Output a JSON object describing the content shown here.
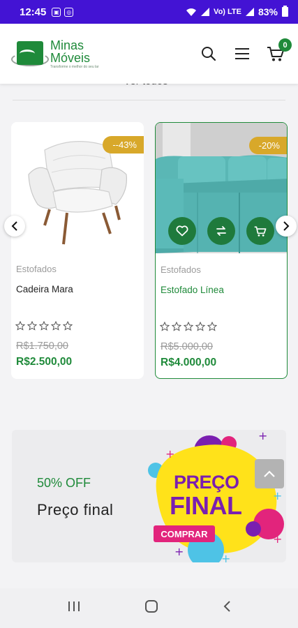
{
  "status_bar": {
    "time": "12:45",
    "battery": "83%",
    "signal_text": "Vo) LTE"
  },
  "header": {
    "logo": {
      "line1": "Minas",
      "line2": "Móveis",
      "tagline": "Transforme o melhor do seu lar"
    },
    "cart_count": "0",
    "icons": [
      "search-icon",
      "menu-icon",
      "cart-icon"
    ]
  },
  "section": {
    "view_all_label": "Ver todos ›"
  },
  "products": [
    {
      "category": "Estofados",
      "name": "Cadeira Mara",
      "discount": "--43%",
      "old_price": "R$1.750,00",
      "price": "R$2.500,00",
      "rating": 0
    },
    {
      "category": "Estofados",
      "name": "Estofado Línea",
      "discount": "-20%",
      "old_price": "R$5.000,00",
      "price": "R$4.000,00",
      "rating": 0
    }
  ],
  "banner": {
    "offer": "50% OFF",
    "title": "Preço final",
    "art_line1": "PREÇO",
    "art_line2": "FINAL",
    "art_button": "COMPRAR"
  },
  "colors": {
    "brand_green": "#1f8a3a",
    "status_bar": "#4313d4",
    "discount_badge": "#d8a82a"
  }
}
